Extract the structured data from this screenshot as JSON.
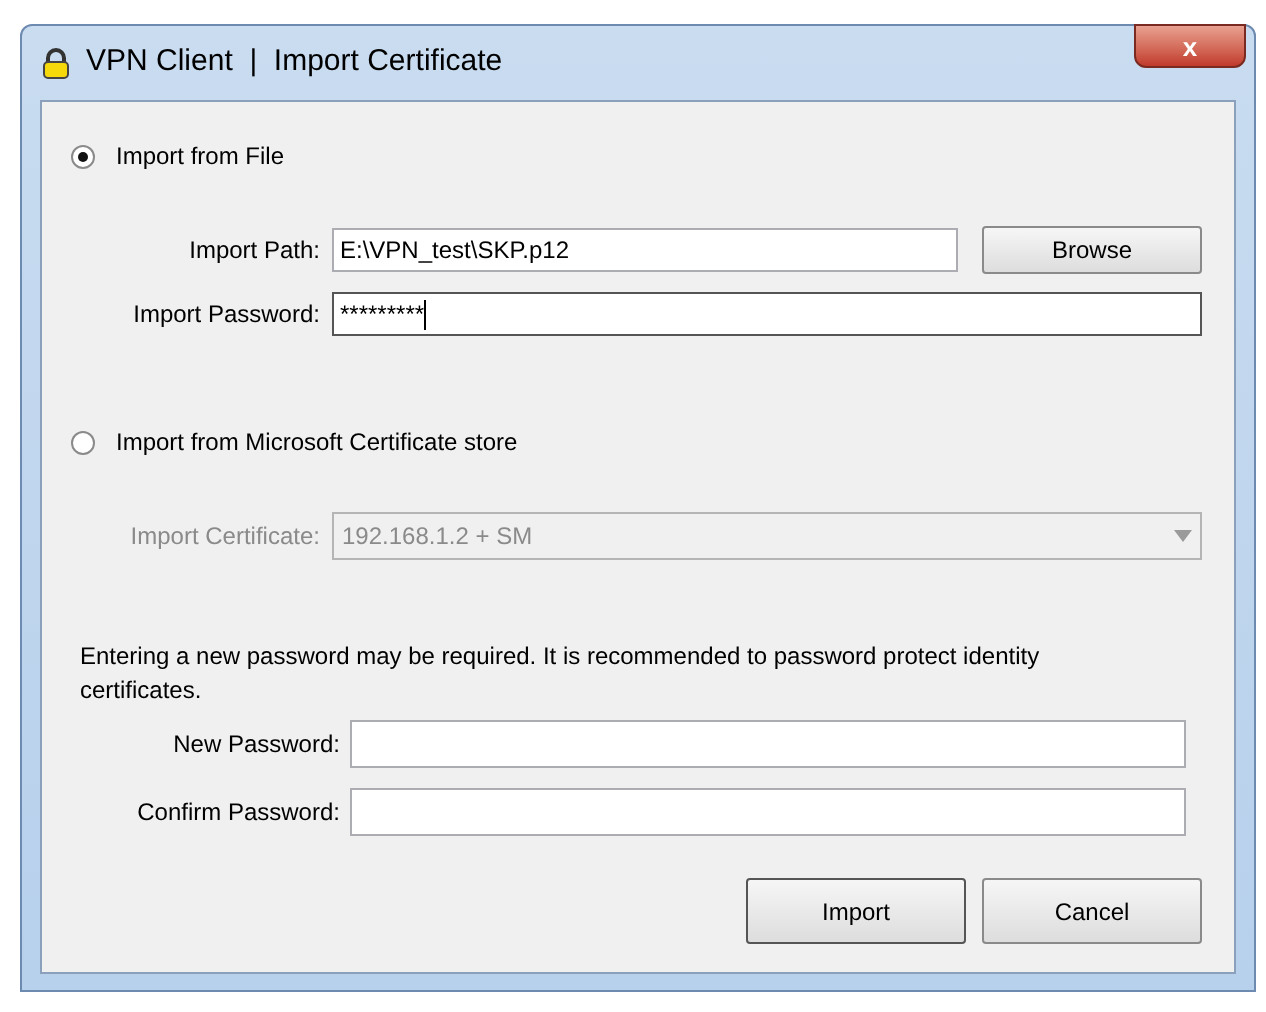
{
  "window": {
    "title": "VPN Client  |  Import Certificate",
    "close": "x"
  },
  "sources": [
    {
      "label": "Import from File",
      "selected": true,
      "fields": [
        {
          "label": "Import Path:",
          "value": "E:\\VPN_test\\SKP.p12",
          "button": "Browse"
        },
        {
          "label": "Import Password:",
          "value": "*********",
          "focused": true
        }
      ]
    },
    {
      "label": "Import from Microsoft Certificate store",
      "selected": false,
      "fields": [
        {
          "label": "Import Certificate:",
          "value": "192.168.1.2 + SM",
          "disabled": true
        }
      ]
    }
  ],
  "note": "Entering a new password may be required.  It is recommended to password protect identity certificates.",
  "passwords": [
    {
      "label": "New Password:"
    },
    {
      "label": "Confirm Password:"
    }
  ],
  "buttons": [
    "Import",
    "Cancel"
  ]
}
